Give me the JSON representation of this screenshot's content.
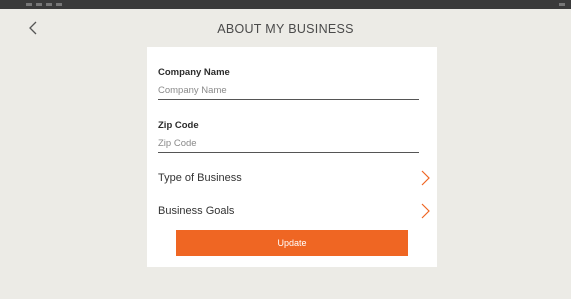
{
  "header": {
    "title": "ABOUT MY BUSINESS",
    "back_icon": "chevron-left-icon"
  },
  "form": {
    "company_name": {
      "label": "Company Name",
      "placeholder": "Company Name",
      "value": ""
    },
    "zip_code": {
      "label": "Zip Code",
      "placeholder": "Zip Code",
      "value": ""
    },
    "rows": [
      {
        "label": "Type of Business",
        "icon": "chevron-right-icon"
      },
      {
        "label": "Business Goals",
        "icon": "chevron-right-icon"
      }
    ],
    "update_label": "Update"
  },
  "colors": {
    "accent": "#ef6623",
    "background": "#ecebe6",
    "card": "#ffffff",
    "statusbar": "#3a3a3a"
  }
}
